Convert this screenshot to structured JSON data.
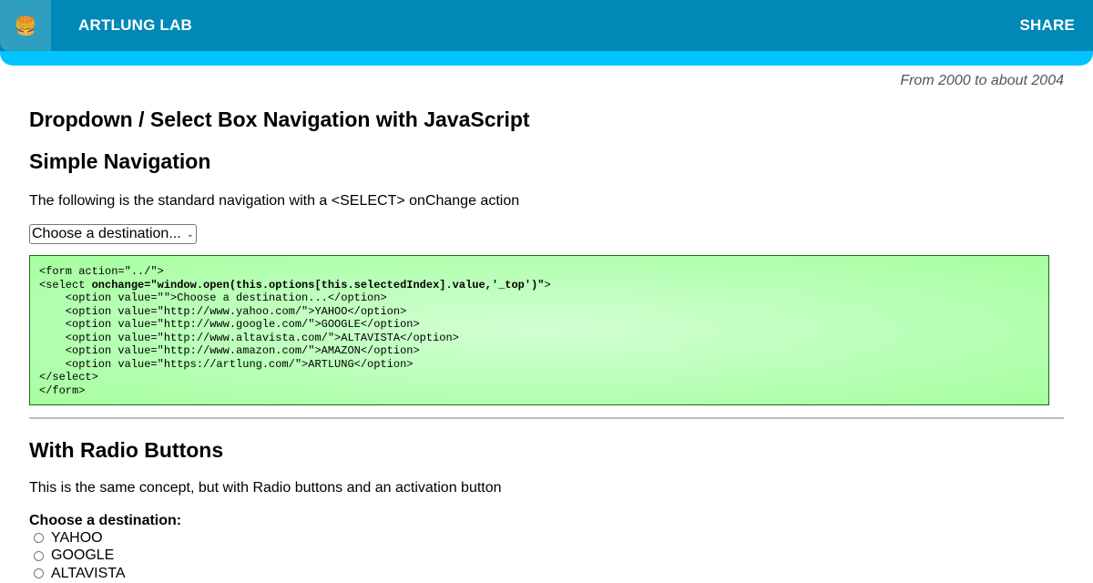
{
  "header": {
    "logo_emoji": "🍔",
    "brand": "ARTLUNG LAB",
    "share_label": "SHARE"
  },
  "era_note": "From 2000 to about 2004",
  "main": {
    "title": "Dropdown / Select Box Navigation with JavaScript",
    "simple": {
      "heading": "Simple Navigation",
      "description": "The following is the standard navigation with a <SELECT> onChange action",
      "select_value": "Choose a destination...",
      "code_lines": [
        "<form action=\"../\">",
        "<select onchange=\"window.open(this.options[this.selectedIndex].value,'_top')\">",
        "    <option value=\"\">Choose a destination...</option>",
        "    <option value=\"http://www.yahoo.com/\">YAHOO</option>",
        "    <option value=\"http://www.google.com/\">GOOGLE</option>",
        "    <option value=\"http://www.altavista.com/\">ALTAVISTA</option>",
        "    <option value=\"http://www.amazon.com/\">AMAZON</option>",
        "    <option value=\"https://artlung.com/\">ARTLUNG</option>",
        "</select>",
        "</form>"
      ],
      "code_bold": "window.open(this.options[this.selectedIndex].value,'_top')"
    },
    "radio": {
      "heading": "With Radio Buttons",
      "description": "This is the same concept, but with Radio buttons and an activation button",
      "label": "Choose a destination:",
      "options": [
        "YAHOO",
        "GOOGLE",
        "ALTAVISTA"
      ]
    }
  }
}
